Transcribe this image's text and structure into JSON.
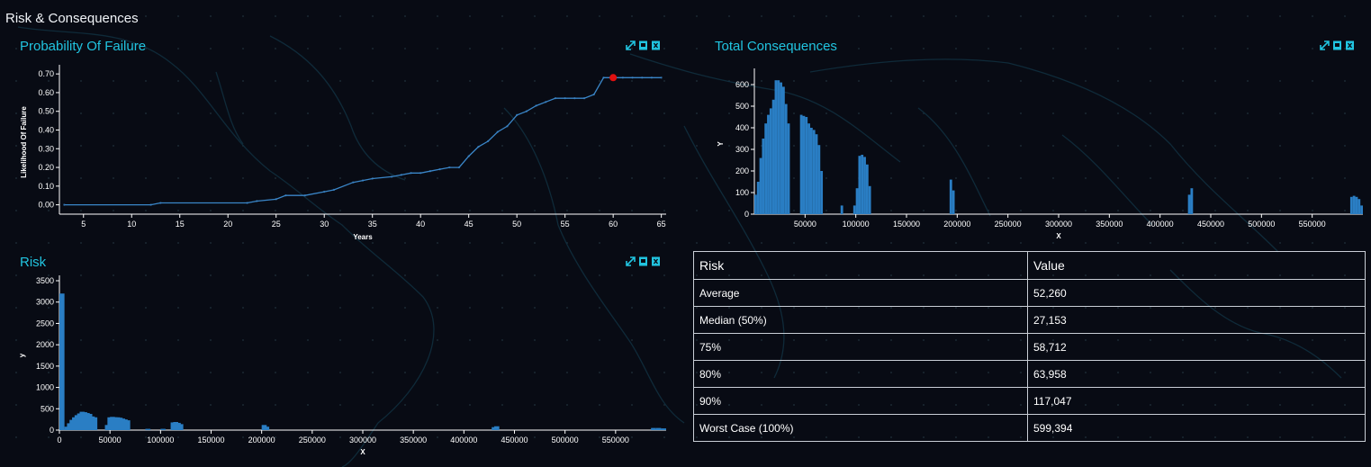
{
  "page_title": "Risk & Consequences",
  "panels": {
    "pof": {
      "title": "Probability Of Failure"
    },
    "tc": {
      "title": "Total Consequences"
    },
    "risk": {
      "title": "Risk"
    }
  },
  "tool_icons": [
    "expand-icon",
    "image-download-icon",
    "excel-download-icon"
  ],
  "colors": {
    "accent": "#21c4e0",
    "bar": "#2a7ec4",
    "line": "#3a86c8",
    "marker": "#e01010",
    "background": "#080b14"
  },
  "table": {
    "headers": [
      "Risk",
      "Value"
    ],
    "rows": [
      [
        "Average",
        "52,260"
      ],
      [
        "Median (50%)",
        "27,153"
      ],
      [
        "75%",
        "58,712"
      ],
      [
        "80%",
        "63,958"
      ],
      [
        "90%",
        "117,047"
      ],
      [
        "Worst Case (100%)",
        "599,394"
      ]
    ]
  },
  "chart_data": [
    {
      "id": "pof",
      "type": "line",
      "title": "Probability Of Failure",
      "xlabel": "Years",
      "ylabel": "Likelihood Of Failure",
      "xlim": [
        2.5,
        65.5
      ],
      "ylim": [
        -0.05,
        0.72
      ],
      "xticks": [
        5,
        10,
        15,
        20,
        25,
        30,
        35,
        40,
        45,
        50,
        55,
        60,
        65
      ],
      "yticks": [
        0,
        0.1,
        0.2,
        0.3,
        0.4,
        0.5,
        0.6,
        0.7
      ],
      "ytick_labels": [
        "0.00",
        "0.10",
        "0.20",
        "0.30",
        "0.40",
        "0.50",
        "0.60",
        "0.70"
      ],
      "x": [
        3,
        12,
        13,
        22,
        23,
        25,
        26,
        28,
        30,
        31,
        33,
        34,
        35,
        37,
        38,
        39,
        40,
        41,
        42,
        43,
        44,
        45,
        46,
        47,
        48,
        49,
        50,
        51,
        52,
        53,
        54,
        55,
        56,
        57,
        58,
        59,
        60,
        61,
        62,
        63,
        64,
        65
      ],
      "y": [
        0,
        0,
        0.01,
        0.01,
        0.02,
        0.03,
        0.05,
        0.05,
        0.07,
        0.08,
        0.12,
        0.13,
        0.14,
        0.15,
        0.16,
        0.17,
        0.17,
        0.18,
        0.19,
        0.2,
        0.2,
        0.26,
        0.31,
        0.34,
        0.39,
        0.42,
        0.48,
        0.5,
        0.53,
        0.55,
        0.57,
        0.57,
        0.57,
        0.57,
        0.59,
        0.68,
        0.68,
        0.68,
        0.68,
        0.68,
        0.68,
        0.68
      ],
      "highlight": {
        "x": 60,
        "y": 0.68
      }
    },
    {
      "id": "tc",
      "type": "bar",
      "title": "Total Consequences",
      "xlabel": "X",
      "ylabel": "Y",
      "xlim": [
        0,
        600000
      ],
      "ylim": [
        0,
        650
      ],
      "xticks": [
        50000,
        100000,
        150000,
        200000,
        250000,
        300000,
        350000,
        400000,
        450000,
        500000,
        550000
      ],
      "yticks": [
        0,
        100,
        200,
        300,
        400,
        500,
        600
      ],
      "bin_width": 2500,
      "bins": [
        [
          0,
          90
        ],
        [
          2500,
          150
        ],
        [
          5000,
          260
        ],
        [
          7500,
          350
        ],
        [
          10000,
          420
        ],
        [
          12500,
          460
        ],
        [
          15000,
          490
        ],
        [
          17500,
          530
        ],
        [
          20000,
          620
        ],
        [
          22500,
          620
        ],
        [
          25000,
          610
        ],
        [
          27500,
          590
        ],
        [
          30000,
          510
        ],
        [
          32500,
          420
        ],
        [
          45000,
          460
        ],
        [
          47500,
          455
        ],
        [
          50000,
          450
        ],
        [
          52500,
          420
        ],
        [
          55000,
          400
        ],
        [
          57500,
          390
        ],
        [
          60000,
          370
        ],
        [
          62500,
          320
        ],
        [
          65000,
          200
        ],
        [
          85000,
          40
        ],
        [
          97500,
          40
        ],
        [
          100000,
          120
        ],
        [
          102500,
          270
        ],
        [
          105000,
          275
        ],
        [
          107500,
          265
        ],
        [
          110000,
          230
        ],
        [
          112500,
          130
        ],
        [
          192500,
          160
        ],
        [
          195000,
          110
        ],
        [
          427500,
          90
        ],
        [
          430000,
          120
        ],
        [
          587500,
          80
        ],
        [
          590000,
          85
        ],
        [
          592500,
          80
        ],
        [
          595000,
          70
        ],
        [
          597500,
          40
        ]
      ]
    },
    {
      "id": "risk",
      "type": "bar",
      "title": "Risk",
      "xlabel": "X",
      "ylabel": "y",
      "xlim": [
        0,
        600000
      ],
      "ylim": [
        0,
        3500
      ],
      "xticks": [
        0,
        50000,
        100000,
        150000,
        200000,
        250000,
        300000,
        350000,
        400000,
        450000,
        500000,
        550000
      ],
      "yticks": [
        0,
        500,
        1000,
        1500,
        2000,
        2500,
        3000,
        3500
      ],
      "bin_width": 5000,
      "bins": [
        [
          0,
          3200
        ],
        [
          5000,
          80
        ],
        [
          7500,
          160
        ],
        [
          10000,
          240
        ],
        [
          12500,
          300
        ],
        [
          15000,
          350
        ],
        [
          17500,
          390
        ],
        [
          20000,
          430
        ],
        [
          22500,
          420
        ],
        [
          25000,
          400
        ],
        [
          27500,
          380
        ],
        [
          30000,
          320
        ],
        [
          32500,
          300
        ],
        [
          45000,
          120
        ],
        [
          47500,
          300
        ],
        [
          50000,
          310
        ],
        [
          52500,
          300
        ],
        [
          55000,
          300
        ],
        [
          57500,
          290
        ],
        [
          60000,
          270
        ],
        [
          62500,
          250
        ],
        [
          65000,
          230
        ],
        [
          85000,
          30
        ],
        [
          100000,
          30
        ],
        [
          110000,
          180
        ],
        [
          112500,
          190
        ],
        [
          115000,
          170
        ],
        [
          117500,
          140
        ],
        [
          200000,
          120
        ],
        [
          202500,
          80
        ],
        [
          427500,
          70
        ],
        [
          430000,
          90
        ],
        [
          585000,
          50
        ],
        [
          590000,
          50
        ],
        [
          595000,
          40
        ]
      ]
    }
  ]
}
